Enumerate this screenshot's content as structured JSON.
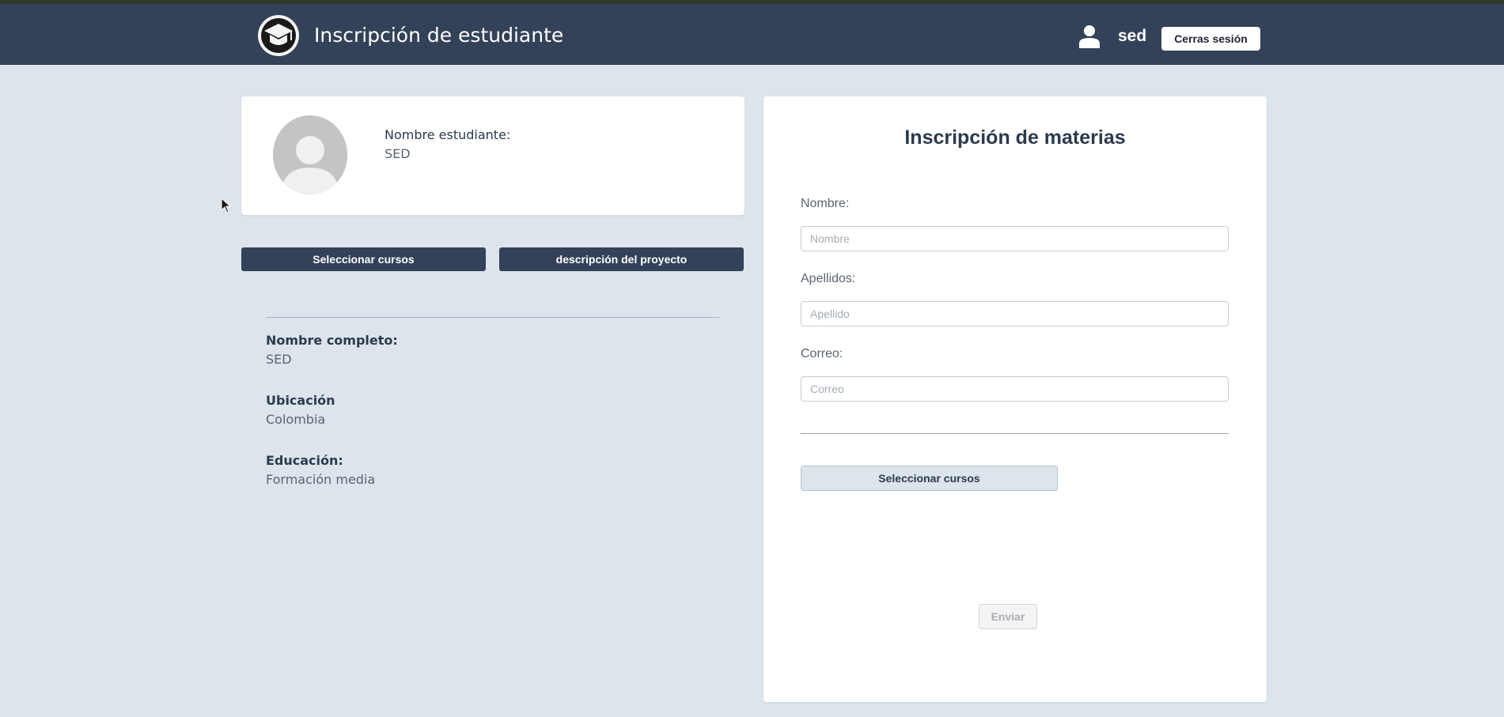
{
  "header": {
    "title": "Inscripción de estudiante",
    "username": "sed",
    "logout_label": "Cerras sesión",
    "logo_icon": "graduation-cap-icon",
    "user_icon": "user-icon"
  },
  "profile": {
    "student_label": "Nombre estudiante:",
    "student_name": "SED",
    "avatar_icon": "avatar-placeholder-icon"
  },
  "actions": {
    "select_courses_label": "Seleccionar cursos",
    "project_description_label": "descripción del proyecto"
  },
  "details": [
    {
      "label": "Nombre completo:",
      "value": "SED"
    },
    {
      "label": "Ubicación",
      "value": "Colombia"
    },
    {
      "label": "Educación:",
      "value": "Formación media"
    }
  ],
  "form": {
    "title": "Inscripción de materias",
    "fields": [
      {
        "label": "Nombre:",
        "placeholder": "Nombre",
        "value": ""
      },
      {
        "label": "Apellidos:",
        "placeholder": "Apellido",
        "value": ""
      },
      {
        "label": "Correo:",
        "placeholder": "Correo",
        "value": ""
      }
    ],
    "select_courses_label": "Seleccionar cursos",
    "submit_label": "Enviar"
  },
  "colors": {
    "header_bg": "#334258",
    "page_bg": "#dce4ec",
    "card_bg": "#ffffff",
    "primary_button": "#334258"
  }
}
